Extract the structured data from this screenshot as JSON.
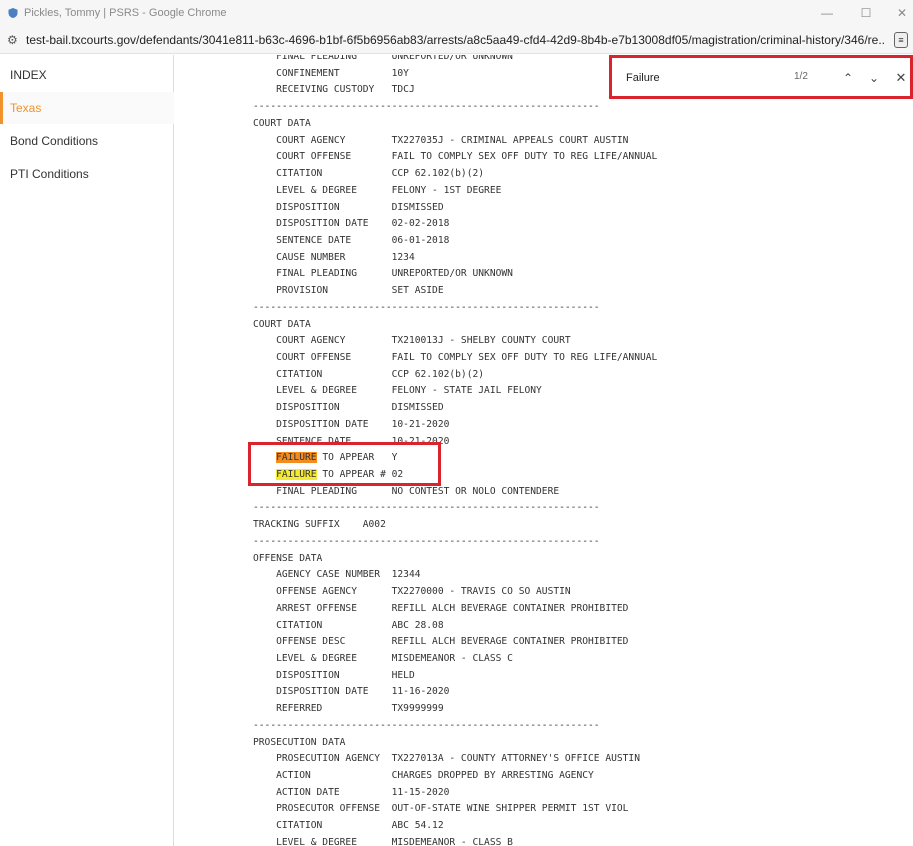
{
  "window": {
    "title": "Pickles, Tommy | PSRS - Google Chrome",
    "minimize_glyph": "—",
    "maximize_glyph": "☐",
    "close_glyph": "✕"
  },
  "address_bar": {
    "url": "test-bail.txcourts.gov/defendants/3041e811-b63c-4696-b1bf-6f5b6956ab83/arrests/a8c5aa49-cfd4-42d9-8b4b-e7b13008df05/magistration/criminal-history/346/re..."
  },
  "sidebar": {
    "items": [
      {
        "label": "INDEX"
      },
      {
        "label": "Texas"
      },
      {
        "label": "Bond Conditions"
      },
      {
        "label": "PTI Conditions"
      }
    ]
  },
  "find_bar": {
    "query": "Failure",
    "count": "1/2",
    "up_glyph": "⌃",
    "down_glyph": "⌄",
    "close_glyph": "✕"
  },
  "report": {
    "lines": [
      "    FINAL PLEADING      UNREPORTED/OR UNKNOWN",
      "    CONFINEMENT         10Y",
      "    RECEIVING CUSTODY   TDCJ",
      "------------------------------------------------------------",
      "COURT DATA",
      "    COURT AGENCY        TX227035J - CRIMINAL APPEALS COURT AUSTIN",
      "    COURT OFFENSE       FAIL TO COMPLY SEX OFF DUTY TO REG LIFE/ANNUAL",
      "    CITATION            CCP 62.102(b)(2)",
      "    LEVEL & DEGREE      FELONY - 1ST DEGREE",
      "    DISPOSITION         DISMISSED",
      "    DISPOSITION DATE    02-02-2018",
      "    SENTENCE DATE       06-01-2018",
      "    CAUSE NUMBER        1234",
      "    FINAL PLEADING      UNREPORTED/OR UNKNOWN",
      "    PROVISION           SET ASIDE",
      "------------------------------------------------------------",
      "COURT DATA",
      "    COURT AGENCY        TX210013J - SHELBY COUNTY COURT",
      "    COURT OFFENSE       FAIL TO COMPLY SEX OFF DUTY TO REG LIFE/ANNUAL",
      "    CITATION            CCP 62.102(b)(2)",
      "    LEVEL & DEGREE      FELONY - STATE JAIL FELONY",
      "    DISPOSITION         DISMISSED",
      "    DISPOSITION DATE    10-21-2020",
      "    SENTENCE DATE       10-21-2020",
      "    FAILURE TO APPEAR   Y",
      "    FAILURE TO APPEAR # 02",
      "    FINAL PLEADING      NO CONTEST OR NOLO CONTENDERE",
      "------------------------------------------------------------",
      "TRACKING SUFFIX    A002",
      "------------------------------------------------------------",
      "OFFENSE DATA",
      "    AGENCY CASE NUMBER  12344",
      "    OFFENSE AGENCY      TX2270000 - TRAVIS CO SO AUSTIN",
      "    ARREST OFFENSE      REFILL ALCH BEVERAGE CONTAINER PROHIBITED",
      "    CITATION            ABC 28.08",
      "    OFFENSE DESC        REFILL ALCH BEVERAGE CONTAINER PROHIBITED",
      "    LEVEL & DEGREE      MISDEMEANOR - CLASS C",
      "    DISPOSITION         HELD",
      "    DISPOSITION DATE    11-16-2020",
      "    REFERRED            TX9999999",
      "------------------------------------------------------------",
      "PROSECUTION DATA",
      "    PROSECUTION AGENCY  TX227013A - COUNTY ATTORNEY'S OFFICE AUSTIN",
      "    ACTION              CHARGES DROPPED BY ARRESTING AGENCY",
      "    ACTION DATE         11-15-2020",
      "    PROSECUTOR OFFENSE  OUT-OF-STATE WINE SHIPPER PERMIT 1ST VIOL",
      "    CITATION            ABC 54.12",
      "    LEVEL & DEGREE      MISDEMEANOR - CLASS B"
    ]
  },
  "colors": {
    "accent": "#f0932b",
    "highlight": "#f4ea2e",
    "highlight_current": "#f28c1e",
    "annotation": "#d9232d"
  },
  "icons": {
    "site": "tune-icon",
    "tab": "shield-icon",
    "extension": "page-icon"
  }
}
